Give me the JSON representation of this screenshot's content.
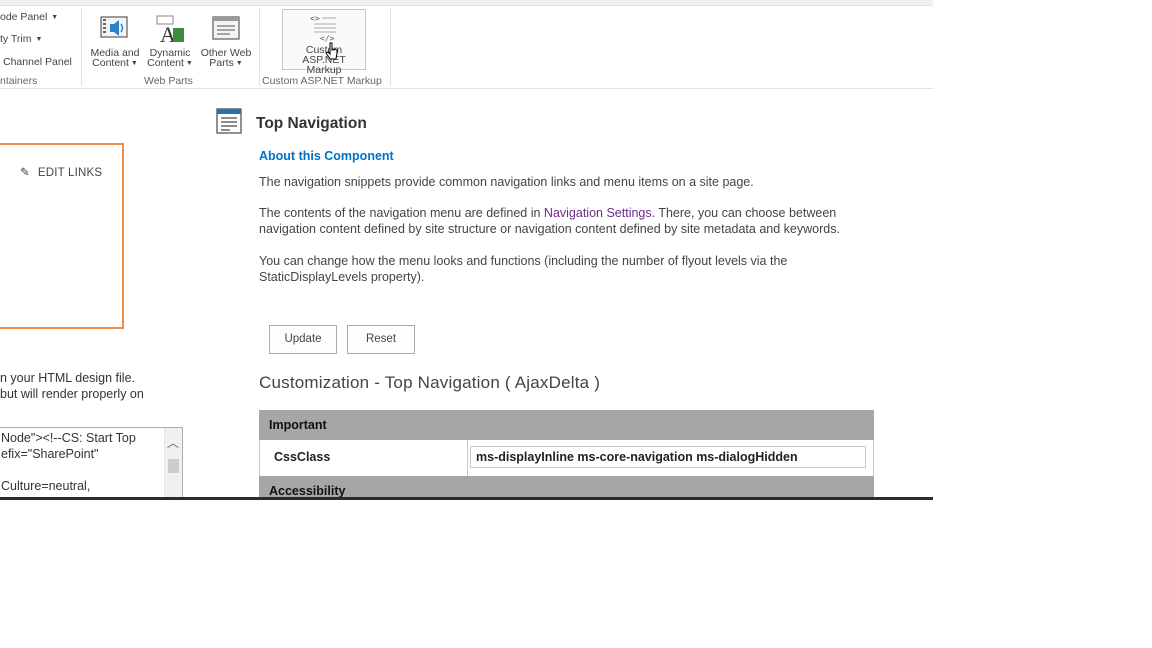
{
  "ribbon": {
    "containers_group": {
      "items": [
        "ode Panel",
        "ty Trim",
        "Channel Panel"
      ],
      "label": "ntainers"
    },
    "web_parts_group": {
      "buttons": [
        {
          "line1": "Media and",
          "line2": "Content",
          "icon": "media-content-icon"
        },
        {
          "line1": "Dynamic",
          "line2": "Content",
          "icon": "dynamic-content-icon"
        },
        {
          "line1": "Other Web",
          "line2": "Parts",
          "icon": "other-web-parts-icon"
        }
      ],
      "label": "Web Parts"
    },
    "custom_group": {
      "button": {
        "line1": "Custom ASP.NET",
        "line2": "Markup",
        "icon": "aspnet-markup-icon"
      },
      "label": "Custom ASP.NET Markup"
    }
  },
  "left": {
    "edit_links": "EDIT LINKS",
    "text_lines": [
      "n your HTML design file.",
      " but will render properly on"
    ],
    "code_lines": [
      "Node\"><!--CS: Start Top",
      "efix=\"SharePoint\"",
      "",
      "Culture=neutral,"
    ]
  },
  "panel": {
    "title": "Top Navigation",
    "about_heading": "About this Component",
    "para1": "The navigation snippets provide common navigation links and menu items on a site page.",
    "para2_before": "The contents of the navigation menu are defined in ",
    "para2_link": "Navigation Settings",
    "para2_after": ". There, you can choose between",
    "para2_line2": "navigation content defined by site structure or navigation content defined by site metadata and keywords.",
    "para3_line1": "You can change how the menu looks and functions (including the number of flyout levels via the",
    "para3_line2": "StaticDisplayLevels property).",
    "update_label": "Update",
    "reset_label": "Reset",
    "customization_heading": "Customization - Top Navigation ( AjaxDelta )",
    "section_important": "Important",
    "prop_label": "CssClass",
    "prop_value": "ms-displayInline ms-core-navigation ms-dialogHidden",
    "section_accessibility": "Accessibility"
  },
  "colors": {
    "accent_link": "#0072c6",
    "visited_link": "#6b2d8e",
    "highlight_border": "#f08c46",
    "section_bar": "#a6a6a6"
  }
}
